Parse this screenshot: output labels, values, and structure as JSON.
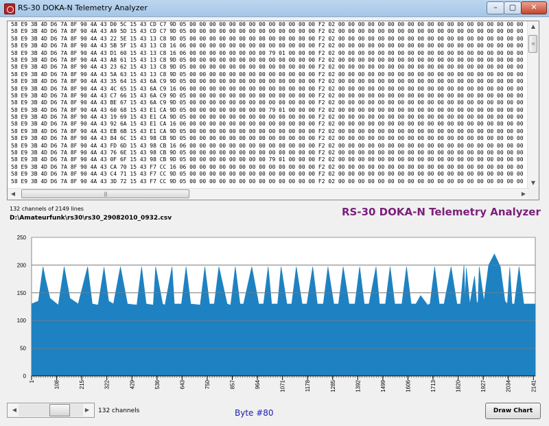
{
  "window": {
    "title": "RS-30 DOKA-N Telemetry Analyzer",
    "buttons": {
      "minimize": "–",
      "maximize": "▢",
      "close": "✕"
    }
  },
  "hex_lines": [
    "58 E9 3B 4D D6 7A 8F 90 4A 43 D0 5C 15 43 CD C7 9D 05 00 00 00 00 00 00 00 00 00 00 00 00 00 F2 02 00 00 00 00 00 00 00 00 00 00 00 00 00 00 00 00 00 00 00",
    "58 E9 3B 4D D6 7A 8F 90 4A 43 A9 5D 15 43 CD C7 9D 05 00 00 00 00 00 00 00 00 00 00 00 00 00 F2 02 00 00 00 00 00 00 00 00 00 00 00 00 00 00 00 00 00 00 00",
    "58 E9 3B 4D D6 7A 8F 90 4A 43 22 5E 15 43 13 C8 9D 05 00 00 00 00 00 00 00 00 00 00 00 00 00 F2 02 00 00 00 00 00 00 00 00 00 00 00 00 00 00 00 00 00 00 00",
    "58 E9 3B 4D D6 7A 8F 90 4A 43 5B 5F 15 43 13 C8 16 06 00 00 00 00 00 00 00 00 00 00 00 00 00 F2 02 00 00 00 00 00 00 00 00 00 00 00 00 00 00 00 00 00 00 00",
    "58 E9 3B 4D D6 7A 8F 90 4A 43 D1 60 15 43 13 C8 16 06 00 00 00 00 00 00 00 00 79 01 00 00 00 F2 02 00 00 00 00 00 00 00 00 00 00 00 00 00 00 00 00 00 00 00",
    "58 E9 3B 4D D6 7A 8F 90 4A 43 A8 61 15 43 13 C8 9D 05 00 00 00 00 00 00 00 00 00 00 00 00 00 F2 02 00 00 00 00 00 00 00 00 00 00 00 00 00 00 00 00 00 00 00",
    "58 E9 3B 4D D6 7A 8F 90 4A 43 23 62 15 43 13 C8 9D 05 00 00 00 00 00 00 00 00 00 00 00 00 00 F2 02 00 00 00 00 00 00 00 00 00 00 00 00 00 00 00 00 00 00 00",
    "58 E9 3B 4D D6 7A 8F 90 4A 43 5A 63 15 43 13 C8 9D 05 00 00 00 00 00 00 00 00 00 00 00 00 00 F2 02 00 00 00 00 00 00 00 00 00 00 00 00 00 00 00 00 00 00 00",
    "58 E9 3B 4D D6 7A 8F 90 4A 43 35 64 15 43 6A C9 9D 05 00 00 00 00 00 00 00 00 00 00 00 00 00 F2 02 00 00 00 00 00 00 00 00 00 00 00 00 00 00 00 00 00 00 00",
    "58 E9 3B 4D D6 7A 8F 90 4A 43 4C 65 15 43 6A C9 16 06 00 00 00 00 00 00 00 00 00 00 00 00 00 F2 02 00 00 00 00 00 00 00 00 00 00 00 00 00 00 00 00 00 00 00",
    "58 E9 3B 4D D6 7A 8F 90 4A 43 C7 66 15 43 6A C9 9D 05 00 00 00 00 00 00 00 00 00 00 00 00 00 F2 02 00 00 00 00 00 00 00 00 00 00 00 00 00 00 00 00 00 00 00",
    "58 E9 3B 4D D6 7A 8F 90 4A 43 BE 67 15 43 6A C9 9D 05 00 00 00 00 00 00 00 00 00 00 00 00 00 F2 02 00 00 00 00 00 00 00 00 00 00 00 00 00 00 00 00 00 00 00",
    "58 E9 3B 4D D6 7A 8F 90 4A 43 60 68 15 43 E1 CA 9D 05 00 00 00 00 00 00 00 00 79 01 00 00 00 F2 02 00 00 00 00 00 00 00 00 00 00 00 00 00 00 00 00 00 00 00",
    "58 E9 3B 4D D6 7A 8F 90 4A 43 19 69 15 43 E1 CA 9D 05 00 00 00 00 00 00 00 00 00 00 00 00 00 F2 02 00 00 00 00 00 00 00 00 00 00 00 00 00 00 00 00 00 00 00",
    "58 E9 3B 4D D6 7A 8F 90 4A 43 92 6A 15 43 E1 CA 16 06 00 00 00 00 00 00 00 00 00 00 00 00 00 F2 02 00 00 00 00 00 00 00 00 00 00 00 00 00 00 00 00 00 00 00",
    "58 E9 3B 4D D6 7A 8F 90 4A 43 EB 6B 15 43 E1 CA 9D 05 00 00 00 00 00 00 00 00 00 00 00 00 00 F2 02 00 00 00 00 00 00 00 00 00 00 00 00 00 00 00 00 00 00 00",
    "58 E9 3B 4D D6 7A 8F 90 4A 43 84 6C 15 43 98 CB 9D 05 00 00 00 00 00 00 00 00 00 00 00 00 00 F2 02 00 00 00 00 00 00 00 00 00 00 00 00 00 00 00 00 00 00 00",
    "58 E9 3B 4D D6 7A 8F 90 4A 43 FD 6D 15 43 98 CB 16 06 00 00 00 00 00 00 00 00 00 00 00 00 00 F2 02 00 00 00 00 00 00 00 00 00 00 00 00 00 00 00 00 00 00 00",
    "58 E9 3B 4D D6 7A 8F 90 4A 43 76 6E 15 43 98 CB 9D 05 00 00 00 00 00 00 00 00 00 00 00 00 00 F2 02 00 00 00 00 00 00 00 00 00 00 00 00 00 00 00 00 00 00 00",
    "58 E9 3B 4D D6 7A 8F 90 4A 43 0F 6F 15 43 98 CB 9D 05 00 00 00 00 00 00 00 00 79 01 00 00 00 F2 02 00 00 00 00 00 00 00 00 00 00 00 00 00 00 00 00 00 00 00",
    "58 E9 3B 4D D6 7A 8F 90 4A 43 CA 70 15 43 F7 CC 16 06 00 00 00 00 00 00 00 00 00 00 00 00 00 F2 02 00 00 00 00 00 00 00 00 00 00 00 00 00 00 00 00 00 00 00",
    "58 E9 3B 4D D6 7A 8F 90 4A 43 C4 71 15 43 F7 CC 9D 05 00 00 00 00 00 00 00 00 00 00 00 00 00 F2 02 00 00 00 00 00 00 00 00 00 00 00 00 00 00 00 00 00 00 00",
    "58 E9 3B 4D D6 7A 8F 90 4A 43 3D 72 15 43 F7 CC 9D 05 00 00 00 00 00 00 00 00 00 00 00 00 00 F2 02 00 00 00 00 00 00 00 00 00 00 00 00 00 00 00 00 00 00 00"
  ],
  "info": {
    "count": "132 channels of 2149 lines",
    "file": "D:\\Amateurfunk\\rs30\\rs30_29082010_0932.csv",
    "heading": "RS-30 DOKA-N Telemetry  Analyzer"
  },
  "controls": {
    "channels_label": "132 channels",
    "byte_label": "Byte #80",
    "draw_button": "Draw Chart",
    "slider_position": 0.7
  },
  "colors": {
    "series": "#1e82c2",
    "heading": "#7b1f7b",
    "byte_label": "#1a1ab0"
  },
  "chart_data": {
    "type": "area",
    "ylim": [
      0,
      250
    ],
    "yticks": [
      0,
      50,
      100,
      150,
      200,
      250
    ],
    "xlim": [
      1,
      2149
    ],
    "xticks": [
      1,
      108,
      215,
      322,
      429,
      536,
      643,
      750,
      857,
      964,
      1071,
      1178,
      1285,
      1392,
      1499,
      1606,
      1713,
      1820,
      1927,
      2034,
      2141
    ],
    "grid": "horizontal",
    "series": [
      {
        "x": [
          1,
          30,
          50,
          60,
          80,
          115,
          140,
          165,
          200,
          240,
          260,
          285,
          310,
          330,
          350,
          380,
          410,
          450,
          470,
          490,
          520,
          530,
          560,
          570,
          600,
          610,
          640,
          660,
          680,
          720,
          740,
          760,
          780,
          800,
          835,
          850,
          870,
          890,
          905,
          940,
          970,
          990,
          1010,
          1025,
          1050,
          1065,
          1090,
          1110,
          1130,
          1155,
          1175,
          1200,
          1220,
          1245,
          1265,
          1290,
          1310,
          1330,
          1355,
          1380,
          1400,
          1420,
          1440,
          1470,
          1485,
          1510,
          1530,
          1550,
          1580,
          1600,
          1620,
          1640,
          1660,
          1690,
          1700,
          1720,
          1740,
          1760,
          1790,
          1815,
          1830,
          1845,
          1850,
          1855,
          1870,
          1890,
          1900,
          1905,
          1910,
          1930,
          1950,
          1975,
          2000,
          2020,
          2030,
          2040,
          2050,
          2060,
          2080,
          2100,
          2130,
          2149
        ],
        "values": [
          130,
          135,
          197,
          175,
          140,
          128,
          197,
          140,
          130,
          197,
          130,
          128,
          196,
          135,
          130,
          197,
          130,
          128,
          197,
          130,
          128,
          197,
          130,
          128,
          197,
          130,
          130,
          197,
          130,
          128,
          197,
          130,
          130,
          197,
          130,
          128,
          197,
          130,
          130,
          197,
          130,
          130,
          197,
          130,
          130,
          197,
          130,
          130,
          197,
          130,
          130,
          197,
          130,
          130,
          197,
          130,
          130,
          197,
          130,
          130,
          197,
          130,
          130,
          197,
          130,
          130,
          197,
          130,
          130,
          197,
          130,
          130,
          145,
          128,
          130,
          197,
          130,
          130,
          197,
          130,
          130,
          200,
          140,
          195,
          130,
          180,
          130,
          135,
          197,
          135,
          200,
          220,
          197,
          135,
          130,
          196,
          130,
          130,
          197,
          130,
          130,
          130
        ]
      }
    ]
  }
}
